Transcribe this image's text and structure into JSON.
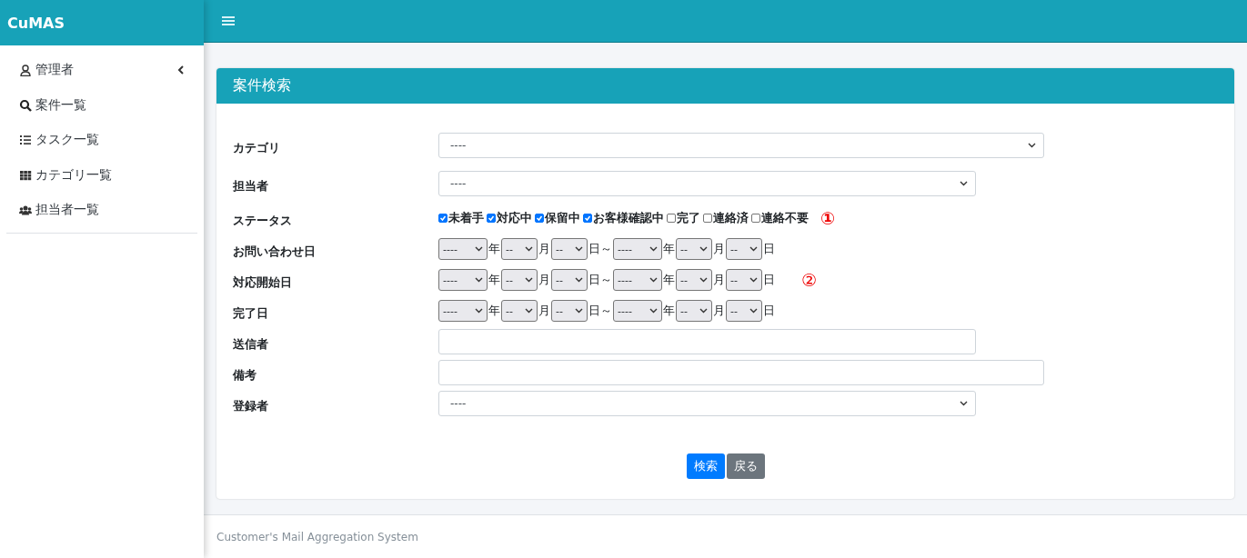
{
  "brand": "CuMAS",
  "sidebar": {
    "items": [
      {
        "label": "管理者",
        "expandable": true
      },
      {
        "label": "案件一覧",
        "expandable": false
      },
      {
        "label": "タスク一覧",
        "expandable": false
      },
      {
        "label": "カテゴリ一覧",
        "expandable": false
      },
      {
        "label": "担当者一覧",
        "expandable": false
      }
    ]
  },
  "card": {
    "title": "案件検索",
    "rows": [
      {
        "kind": "select",
        "label": "カテゴリ",
        "value": "----"
      },
      {
        "kind": "select",
        "label": "担当者",
        "value": "----"
      },
      {
        "kind": "checkboxes",
        "label": "ステータス",
        "note": "①",
        "options": [
          {
            "label": "未着手",
            "checked": true
          },
          {
            "label": "対応中",
            "checked": true
          },
          {
            "label": "保留中",
            "checked": true
          },
          {
            "label": "お客様確認中",
            "checked": true
          },
          {
            "label": "完了",
            "checked": false
          },
          {
            "label": "連絡済",
            "checked": false
          },
          {
            "label": "連絡不要",
            "checked": false
          }
        ]
      },
      {
        "kind": "dates",
        "label": "お問い合わせ日",
        "parts": [
          {
            "value": "----",
            "unit": "年"
          },
          {
            "value": "--",
            "unit": "月"
          },
          {
            "value": "--",
            "unit": "日～"
          },
          {
            "value": "----",
            "unit": "年"
          },
          {
            "value": "--",
            "unit": "月"
          },
          {
            "value": "--",
            "unit": "日"
          }
        ]
      },
      {
        "kind": "dates",
        "label": "対応開始日",
        "note": "②",
        "parts": [
          {
            "value": "----",
            "unit": "年"
          },
          {
            "value": "--",
            "unit": "月"
          },
          {
            "value": "--",
            "unit": "日～"
          },
          {
            "value": "----",
            "unit": "年"
          },
          {
            "value": "--",
            "unit": "月"
          },
          {
            "value": "--",
            "unit": "日"
          }
        ]
      },
      {
        "kind": "dates",
        "label": "完了日",
        "parts": [
          {
            "value": "----",
            "unit": "年"
          },
          {
            "value": "--",
            "unit": "月"
          },
          {
            "value": "--",
            "unit": "日～"
          },
          {
            "value": "----",
            "unit": "年"
          },
          {
            "value": "--",
            "unit": "月"
          },
          {
            "value": "--",
            "unit": "日"
          }
        ]
      },
      {
        "kind": "text",
        "label": "送信者"
      },
      {
        "kind": "text",
        "label": "備考"
      },
      {
        "kind": "select",
        "label": "登録者",
        "value": "----"
      }
    ],
    "buttons": [
      {
        "label": "検索",
        "kind": "primary"
      },
      {
        "label": "戻る",
        "kind": "secondary"
      }
    ]
  },
  "footer": "Customer's Mail Aggregation System"
}
